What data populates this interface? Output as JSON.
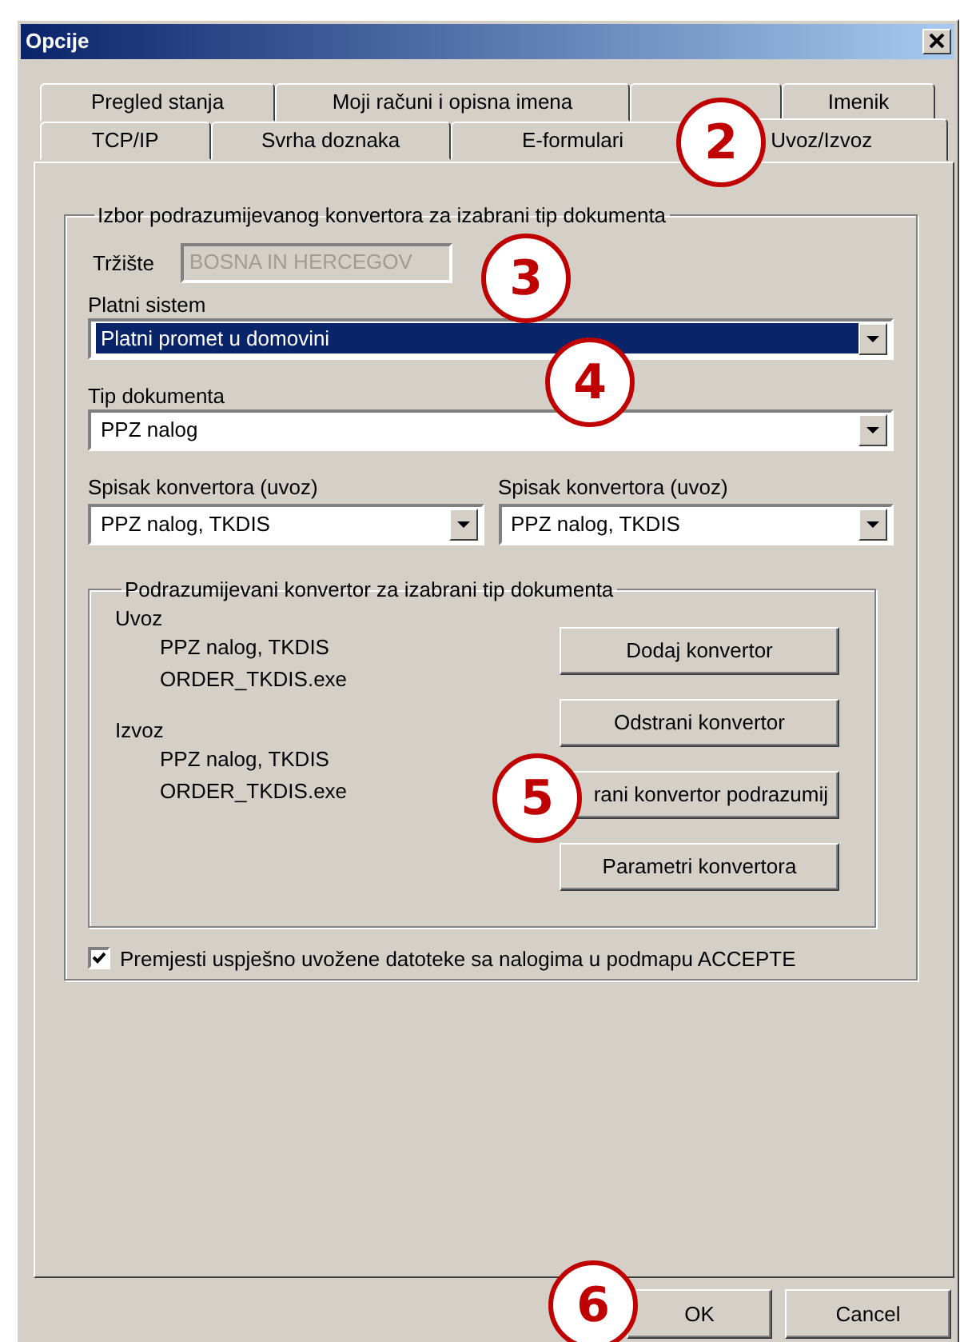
{
  "window": {
    "title": "Opcije"
  },
  "tab_rows": [
    {
      "tabs": [
        {
          "label": "Pregled stanja",
          "selected": false
        },
        {
          "label": "Moji računi i opisna imena",
          "selected": false
        },
        {
          "selected": false
        },
        {
          "label": "Imenik",
          "selected": false
        }
      ]
    },
    {
      "tabs": [
        {
          "label": "TCP/IP",
          "selected": false
        },
        {
          "label": "Svrha doznaka",
          "selected": false
        },
        {
          "label": "E-formulari",
          "selected": false
        },
        {
          "label": "Uvoz/Izvoz",
          "selected": true
        }
      ]
    }
  ],
  "group": {
    "title": "Izbor podrazumijevanog konvertora za izabrani tip dokumenta",
    "market": {
      "label": "Tržište",
      "value": "BOSNA IN HERCEGOV",
      "disabled": true
    },
    "payment_system": {
      "label": "Platni sistem",
      "value": "Platni promet u domovini",
      "selected": true
    },
    "document_type": {
      "label": "Tip dokumenta",
      "value": "PPZ nalog",
      "selected": false
    },
    "converter_lists": [
      {
        "label": "Spisak konvertora (uvoz)",
        "value": "PPZ nalog, TKDIS"
      },
      {
        "label": "Spisak konvertora (uvoz)",
        "value": "PPZ nalog, TKDIS"
      }
    ],
    "default_converter": {
      "title": "Podrazumijevani konvertor za izabrani tip dokumenta",
      "sections": [
        {
          "label": "Uvoz",
          "lines": [
            "PPZ nalog, TKDIS",
            "ORDER_TKDIS.exe"
          ]
        },
        {
          "label": "Izvoz",
          "lines": [
            "PPZ nalog, TKDIS",
            "ORDER_TKDIS.exe"
          ]
        }
      ],
      "buttons": [
        "Dodaj konvertor",
        "Odstrani konvertor",
        "rani konvertor podrazumij",
        "Parametri konvertora"
      ]
    },
    "move_option": {
      "label": "Premjesti uspješno uvožene datoteke sa nalogima u podmapu ACCEPTE",
      "checked": true
    }
  },
  "buttons": [
    "OK",
    "Cancel"
  ],
  "callouts": [
    "2",
    "3",
    "4",
    "5",
    "6"
  ]
}
